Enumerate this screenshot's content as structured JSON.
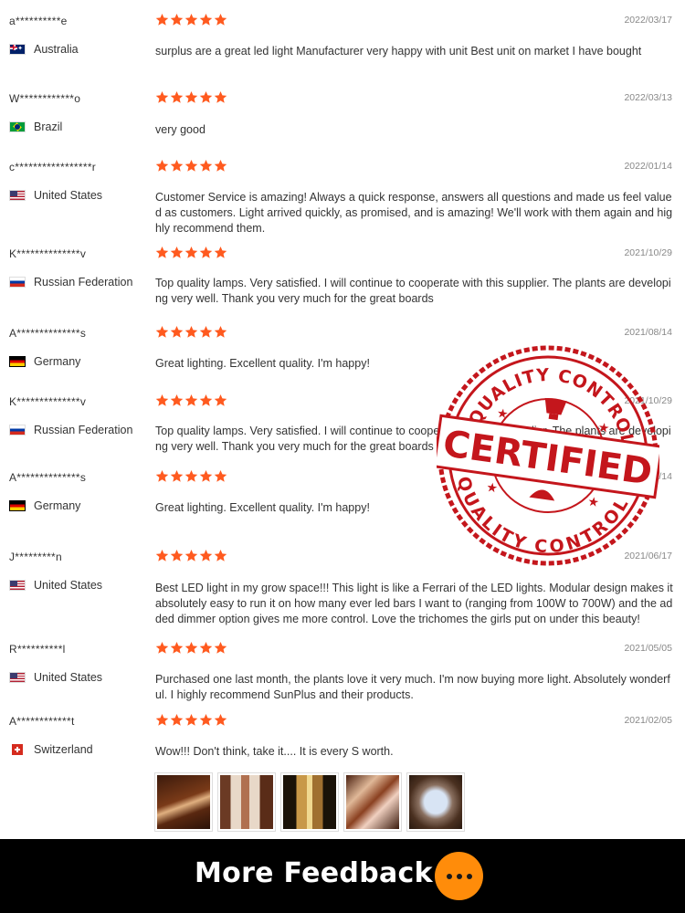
{
  "colors": {
    "star": "#ff5a1f",
    "accent": "#ff8c0a",
    "stamp": "#c4161c"
  },
  "reviews": [
    {
      "user": "a**********e",
      "country": "Australia",
      "flag": "au",
      "date": "2022/03/17",
      "rating": 5,
      "text": "surplus are a great led light Manufacturer very happy with unit Best unit on market I have bought"
    },
    {
      "user": "W************o",
      "country": "Brazil",
      "flag": "br",
      "date": "2022/03/13",
      "rating": 5,
      "text": "very good"
    },
    {
      "user": "c*****************r",
      "country": "United States",
      "flag": "us",
      "date": "2022/01/14",
      "rating": 5,
      "text": "Customer Service is amazing! Always a quick response, answers all questions and made us feel valued as customers. Light arrived quickly, as promised, and is amazing! We'll work with them again and highly recommend them."
    },
    {
      "user": "K**************v",
      "country": "Russian Federation",
      "flag": "ru",
      "date": "2021/10/29",
      "rating": 5,
      "text": "Top quality lamps. Very satisfied. I will continue to cooperate with this supplier. The plants are developing very well. Thank you very much for the great boards"
    },
    {
      "user": "A**************s",
      "country": "Germany",
      "flag": "de",
      "date": "2021/08/14",
      "rating": 5,
      "text": "Great lighting. Excellent quality. I'm happy!"
    },
    {
      "user": "K**************v",
      "country": "Russian Federation",
      "flag": "ru",
      "date": "2021/10/29",
      "rating": 5,
      "text": "Top quality lamps. Very satisfied. I will continue to cooperate with this supplier. The plants are developing very well. Thank you very much for the great boards"
    },
    {
      "user": "A**************s",
      "country": "Germany",
      "flag": "de",
      "date": "2021/08/14",
      "rating": 5,
      "text": "Great lighting. Excellent quality. I'm happy!"
    },
    {
      "user": "J*********n",
      "country": "United States",
      "flag": "us",
      "date": "2021/06/17",
      "rating": 5,
      "text": "Best LED light in my grow space!!! This light is like a Ferrari of the LED lights. Modular design makes it absolutely easy to run it on how many ever led bars I want to (ranging from 100W to 700W) and the added dimmer option gives me more control. Love the trichomes the girls put on under this beauty!"
    },
    {
      "user": "R**********l",
      "country": "United States",
      "flag": "us",
      "date": "2021/05/05",
      "rating": 5,
      "text": "Purchased one last month, the plants love it very much. I'm now buying more light. Absolutely wonderful. I highly recommend SunPlus and their products."
    },
    {
      "user": "A************t",
      "country": "Switzerland",
      "flag": "ch",
      "date": "2021/02/05",
      "rating": 5,
      "text": "Wow!!! Don't think, take it.... It is every S worth."
    }
  ],
  "stamp": {
    "top_text": "QUALITY CONTROL",
    "main_text": "CERTIFIED",
    "bottom_text": "QUALITY CONTROL"
  },
  "footer": {
    "label": "More Feedback",
    "more_icon": "more-dots-icon"
  }
}
